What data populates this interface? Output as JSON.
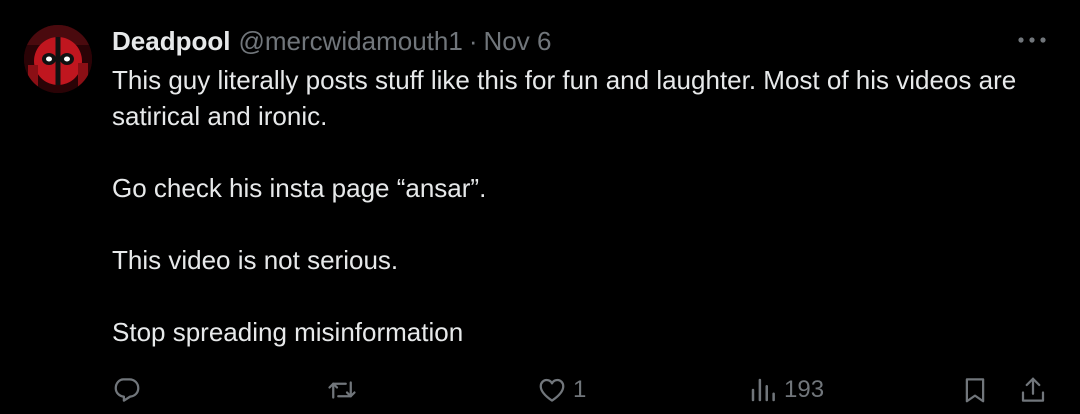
{
  "tweet": {
    "display_name": "Deadpool",
    "handle": "@mercwidamouth1",
    "separator": "·",
    "date": "Nov 6",
    "avatar_icon": "deadpool-avatar-icon",
    "more_icon": "more-options-icon",
    "paragraphs": [
      "This guy literally posts stuff like this for fun and laughter. Most of his videos are satirical and ironic.",
      "Go check his insta page “ansar”.",
      "This video is not serious.",
      "Stop spreading misinformation"
    ],
    "actions": {
      "reply": {
        "icon": "reply-icon",
        "count": ""
      },
      "retweet": {
        "icon": "retweet-icon",
        "count": ""
      },
      "like": {
        "icon": "heart-icon",
        "count": "1"
      },
      "views": {
        "icon": "views-icon",
        "count": "193"
      },
      "bookmark": {
        "icon": "bookmark-icon"
      },
      "share": {
        "icon": "share-icon"
      }
    }
  },
  "colors": {
    "background": "#000000",
    "primary_text": "#e7e9ea",
    "secondary_text": "#71767b",
    "avatar_red": "#c0161f"
  }
}
